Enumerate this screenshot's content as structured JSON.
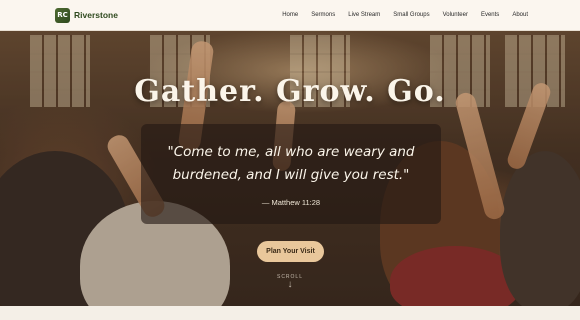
{
  "brand": {
    "logo_text": "RC",
    "name": "Riverstone"
  },
  "nav": {
    "items": [
      "Home",
      "Sermons",
      "Live Stream",
      "Small Groups",
      "Volunteer",
      "Events",
      "About"
    ]
  },
  "hero": {
    "headline": "Gather. Grow. Go.",
    "quote": "\"Come to me, all who are weary and burdened, and I will give you rest.\"",
    "reference": "— Matthew 11:28",
    "cta_label": "Plan Your Visit",
    "scroll_label": "SCROLL",
    "scroll_arrow": "↓"
  },
  "colors": {
    "brand": "#2f4a1f",
    "accent": "#e9c79b",
    "header_bg": "#fbf6ef",
    "headline": "#fbf5ea"
  }
}
